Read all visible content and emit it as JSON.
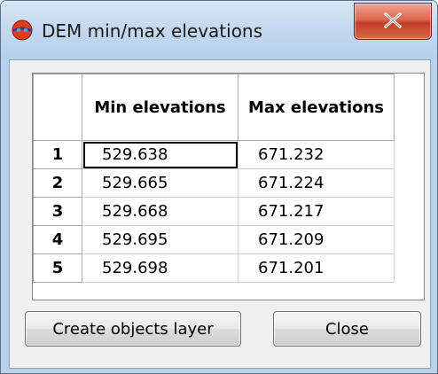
{
  "window": {
    "title": "DEM min/max elevations"
  },
  "icons": {
    "app": "globe-icon",
    "close": "close-icon"
  },
  "table": {
    "columns": [
      "Min elevations",
      "Max elevations"
    ],
    "rows": [
      {
        "index": "1",
        "min": "529.638",
        "max": "671.232"
      },
      {
        "index": "2",
        "min": "529.665",
        "max": "671.224"
      },
      {
        "index": "3",
        "min": "529.668",
        "max": "671.217"
      },
      {
        "index": "4",
        "min": "529.695",
        "max": "671.209"
      },
      {
        "index": "5",
        "min": "529.698",
        "max": "671.201"
      }
    ]
  },
  "buttons": {
    "create_label": "Create objects layer",
    "close_label": "Close"
  },
  "colors": {
    "titlebar": "#c4d9f0",
    "close_button": "#c23f26",
    "dialog_background": "#f0f0f0"
  }
}
